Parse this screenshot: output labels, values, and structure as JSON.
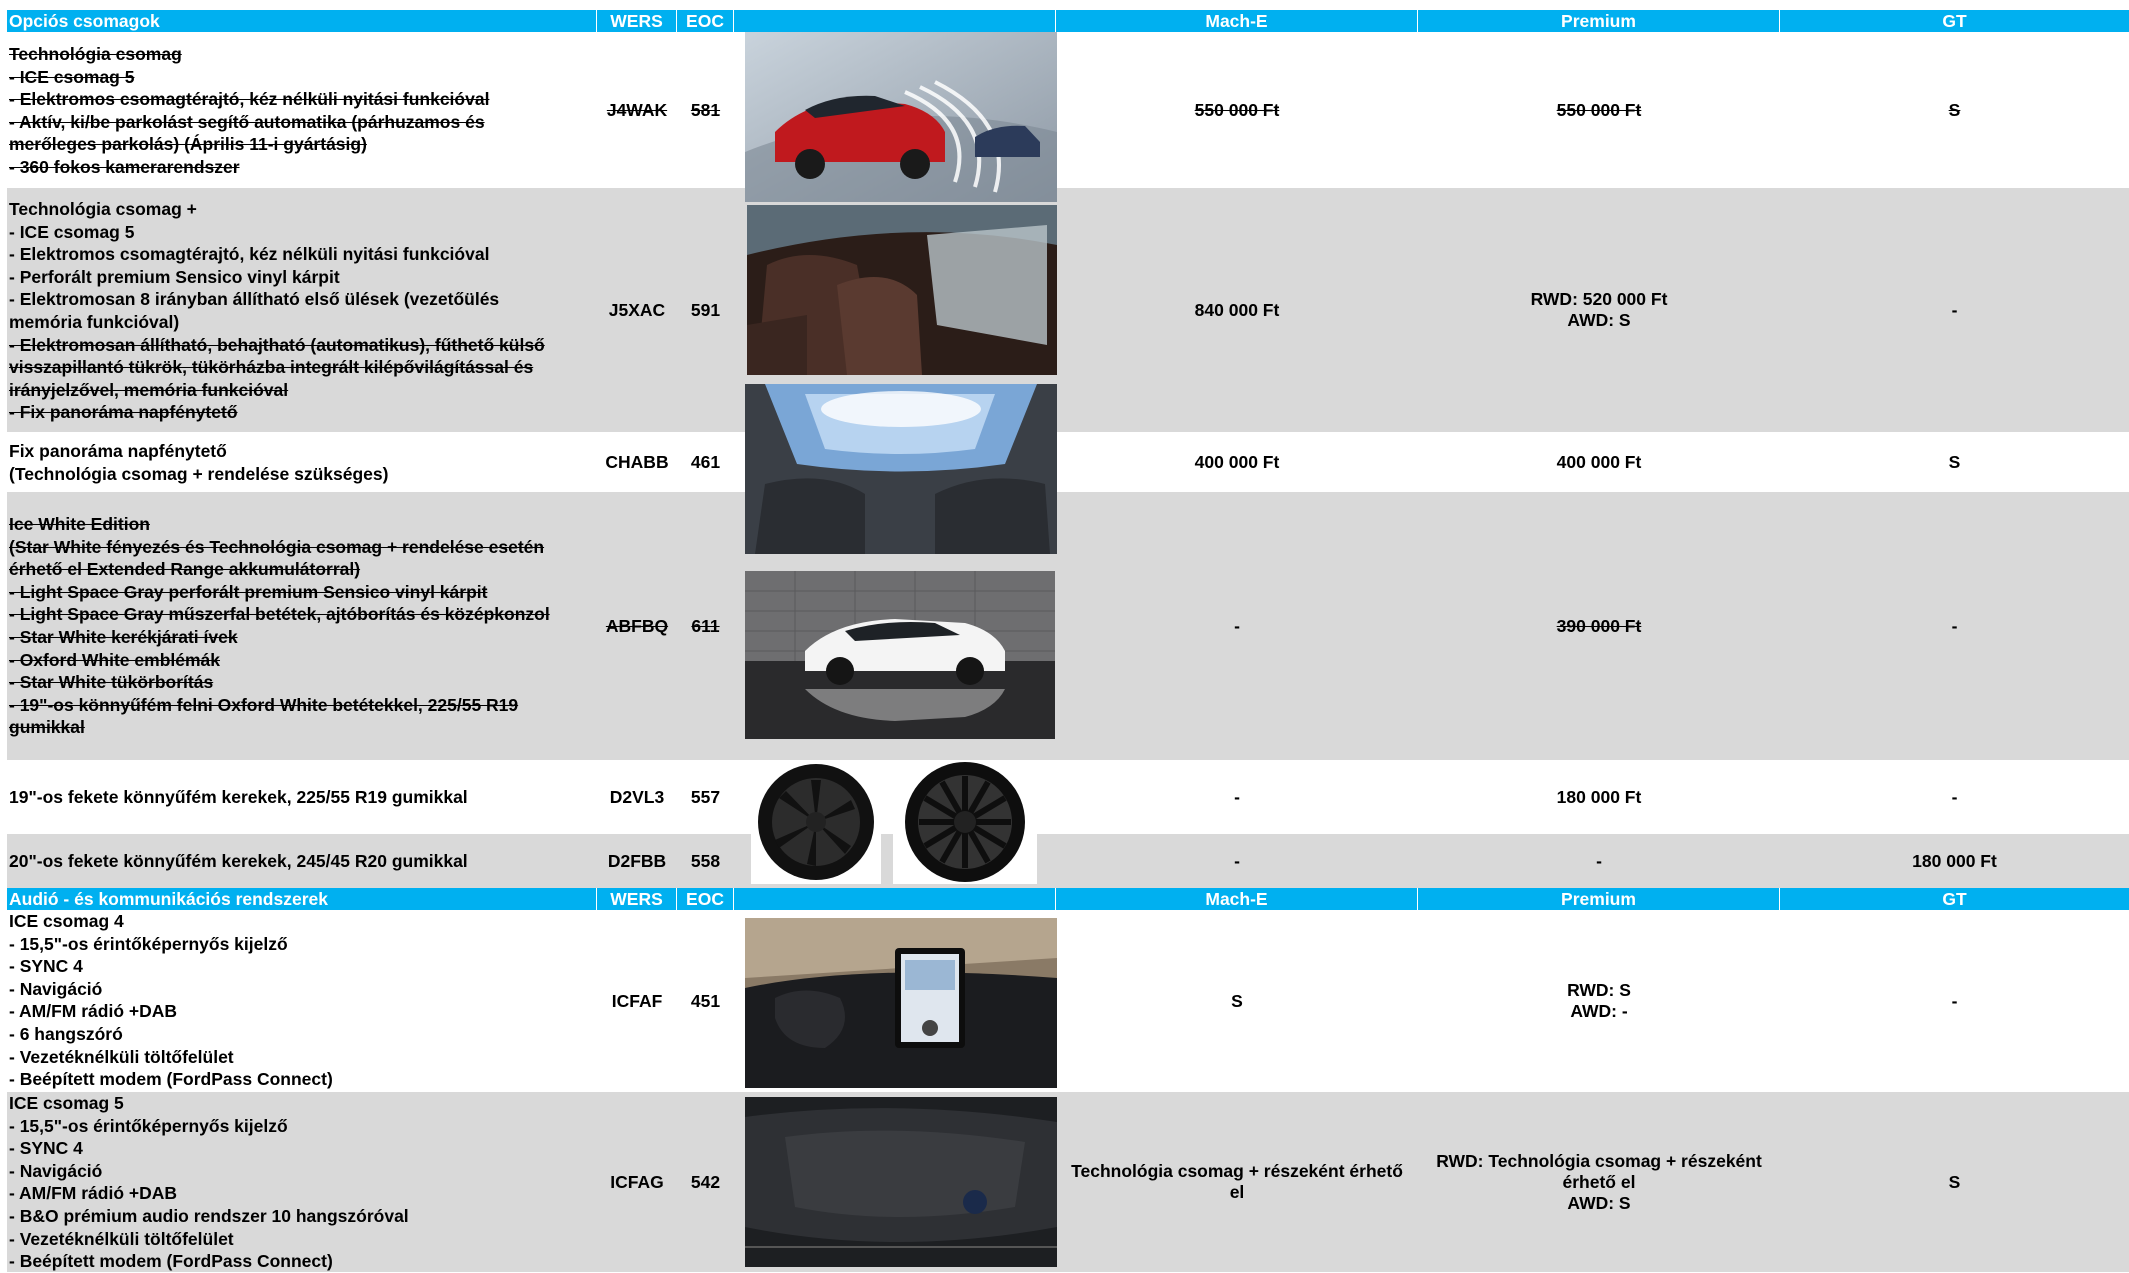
{
  "section1": {
    "header": {
      "title": "Opciós csomagok",
      "wers": "WERS",
      "eoc": "EOC",
      "img": "",
      "mach_e": "Mach-E",
      "premium": "Premium",
      "gt": "GT"
    },
    "rows": [
      {
        "lines": [
          "Technológia csomag",
          "- ICE csomag 5",
          "- Elektromos csomagtérajtó, kéz nélküli nyitási funkcióval",
          "- Aktív, ki/be parkolást segítő automatika (párhuzamos és",
          "merőleges parkolás) (Április 11-i gyártásig)",
          "- 360 fokos kamerarendszer"
        ],
        "wers": "J4WAK",
        "eoc": "581",
        "mach_e": "550 000 Ft",
        "premium": "550 000 Ft",
        "gt": "S"
      },
      {
        "lines": [
          "Technológia csomag +",
          "- ICE csomag 5",
          "- Elektromos csomagtérajtó, kéz nélküli nyitási funkcióval",
          "- Perforált premium Sensico vinyl kárpit",
          "- Elektromosan 8 irányban állítható első ülések (vezetőülés",
          "memória funkcióval)"
        ],
        "lines_struck": [
          "- Elektromosan állítható, behajtható (automatikus), fűthető külső",
          "visszapillantó tükrök, tükörházba integrált kilépővilágítással és",
          "irányjelzővel, memória funkcióval",
          "- Fix panoráma napfénytető"
        ],
        "wers": "J5XAC",
        "eoc": "591",
        "mach_e": "840 000 Ft",
        "premium_lines": [
          "RWD: 520 000 Ft",
          "AWD: S"
        ],
        "gt": "-"
      },
      {
        "lines": [
          "Fix panoráma napfénytető",
          "(Technológia csomag + rendelése szükséges)"
        ],
        "wers": "CHABB",
        "eoc": "461",
        "mach_e": "400 000 Ft",
        "premium": "400 000 Ft",
        "gt": "S"
      },
      {
        "lines": [
          "Ice White Edition",
          "(Star White fényezés és Technológia csomag + rendelése esetén",
          "érhető el Extended Range akkumulátorral)",
          "- Light Space Gray perforált premium Sensico vinyl kárpit",
          "- Light Space Gray műszerfal betétek, ajtóborítás és középkonzol",
          "- Star White kerékjárati ívek",
          "- Oxford White emblémák",
          "- Star White tükörborítás",
          "- 19\"-os könnyűfém felni Oxford White betétekkel, 225/55 R19",
          "gumikkal"
        ],
        "wers": "ABFBQ",
        "eoc": "611",
        "mach_e": "-",
        "premium": "390 000 Ft",
        "gt": "-"
      },
      {
        "lines": [
          "19\"-os fekete könnyűfém kerekek, 225/55 R19 gumikkal"
        ],
        "wers": "D2VL3",
        "eoc": "557",
        "mach_e": "-",
        "premium": "180 000 Ft",
        "gt": "-"
      },
      {
        "lines": [
          "20\"-os fekete könnyűfém kerekek, 245/45 R20 gumikkal"
        ],
        "wers": "D2FBB",
        "eoc": "558",
        "mach_e": "-",
        "premium": "-",
        "gt": "180 000 Ft"
      }
    ]
  },
  "section2": {
    "header": {
      "title": "Audió - és kommunikációs rendszerek",
      "wers": "WERS",
      "eoc": "EOC",
      "img": "",
      "mach_e": "Mach-E",
      "premium": "Premium",
      "gt": "GT"
    },
    "rows": [
      {
        "lines": [
          "ICE csomag 4",
          "- 15,5\"-os érintőképernyős kijelző",
          "- SYNC 4",
          "- Navigáció",
          "- AM/FM rádió +DAB",
          "- 6 hangszóró",
          "- Vezetéknélküli töltőfelület",
          "- Beépített modem (FordPass Connect)"
        ],
        "wers": "ICFAF",
        "eoc": "451",
        "mach_e": "S",
        "premium_lines": [
          "RWD: S",
          "AWD: -"
        ],
        "gt": "-"
      },
      {
        "lines": [
          "ICE csomag 5",
          "- 15,5\"-os érintőképernyős kijelző",
          "- SYNC 4",
          "- Navigáció",
          "- AM/FM rádió +DAB",
          "- B&O prémium audio rendszer 10 hangszóróval",
          "- Vezetéknélküli töltőfelület",
          "- Beépített modem (FordPass Connect)"
        ],
        "wers": "ICFAG",
        "eoc": "542",
        "mach_e_lines": [
          "Technológia csomag + részeként érhető",
          "el"
        ],
        "premium_lines": [
          "RWD: Technológia csomag + részeként",
          "érhető el",
          "AWD: S"
        ],
        "gt": "S"
      }
    ]
  },
  "images": {
    "car_red": "red-suv-parking-assist-photo",
    "interior": "interior-seats-photo",
    "roof": "panoramic-roof-photo",
    "white_car": "ice-white-edition-car-photo",
    "wheel19": "black-19-inch-wheel-icon",
    "wheel20": "black-20-inch-wheel-icon",
    "dashboard": "sync4-touchscreen-dashboard-photo",
    "bo_speaker": "bo-dashboard-speaker-photo"
  }
}
